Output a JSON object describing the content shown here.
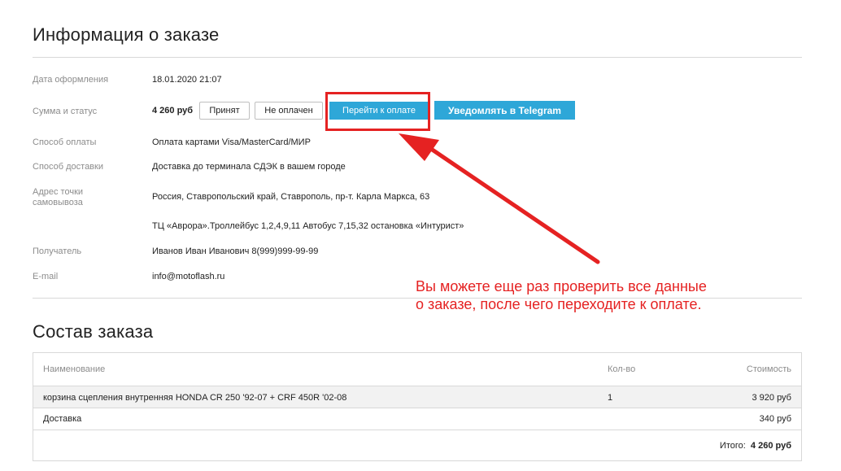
{
  "order_info": {
    "title": "Информация о заказе",
    "fields": {
      "date": {
        "label": "Дата оформления",
        "value": "18.01.2020 21:07"
      },
      "sum_status": {
        "label": "Сумма и статус",
        "sum": "4 260 руб",
        "status_accepted": "Принят",
        "status_unpaid": "Не оплачен"
      },
      "payment_method": {
        "label": "Способ оплаты",
        "value": "Оплата картами Visa/MasterCard/МИР"
      },
      "delivery_method": {
        "label": "Способ доставки",
        "value": "Доставка до терминала СДЭК в вашем городе"
      },
      "pickup_address": {
        "label": "Адрес точки самовывоза",
        "line1": "Россия, Ставропольский край, Ставрополь, пр-т. Карла Маркса, 63",
        "line2": "ТЦ «Аврора».Троллейбус 1,2,4,9,11 Автобус 7,15,32 остановка «Интурист»"
      },
      "recipient": {
        "label": "Получатель",
        "value": "Иванов Иван Иванович 8(999)999-99-99"
      },
      "email": {
        "label": "E-mail",
        "value": "info@motoflash.ru"
      }
    },
    "buttons": {
      "pay": "Перейти к оплате",
      "telegram": "Уведомлять в Telegram"
    }
  },
  "annotation": {
    "line1": "Вы можете еще раз проверить все данные",
    "line2": "о заказе, после чего переходите к оплате.",
    "color": "#e52222"
  },
  "order_items": {
    "title": "Состав заказа",
    "columns": {
      "name": "Наименование",
      "qty": "Кол-во",
      "price": "Стоимость"
    },
    "rows": [
      {
        "name": "корзина сцепления внутренняя HONDA CR 250 '92-07 + CRF 450R '02-08",
        "qty": "1",
        "price": "3 920 руб"
      },
      {
        "name": "Доставка",
        "qty": "",
        "price": "340 руб"
      }
    ],
    "total_label": "Итого:",
    "total_value": "4 260 руб"
  },
  "colors": {
    "accent": "#2ea7d8",
    "annotation_red": "#e52222"
  }
}
